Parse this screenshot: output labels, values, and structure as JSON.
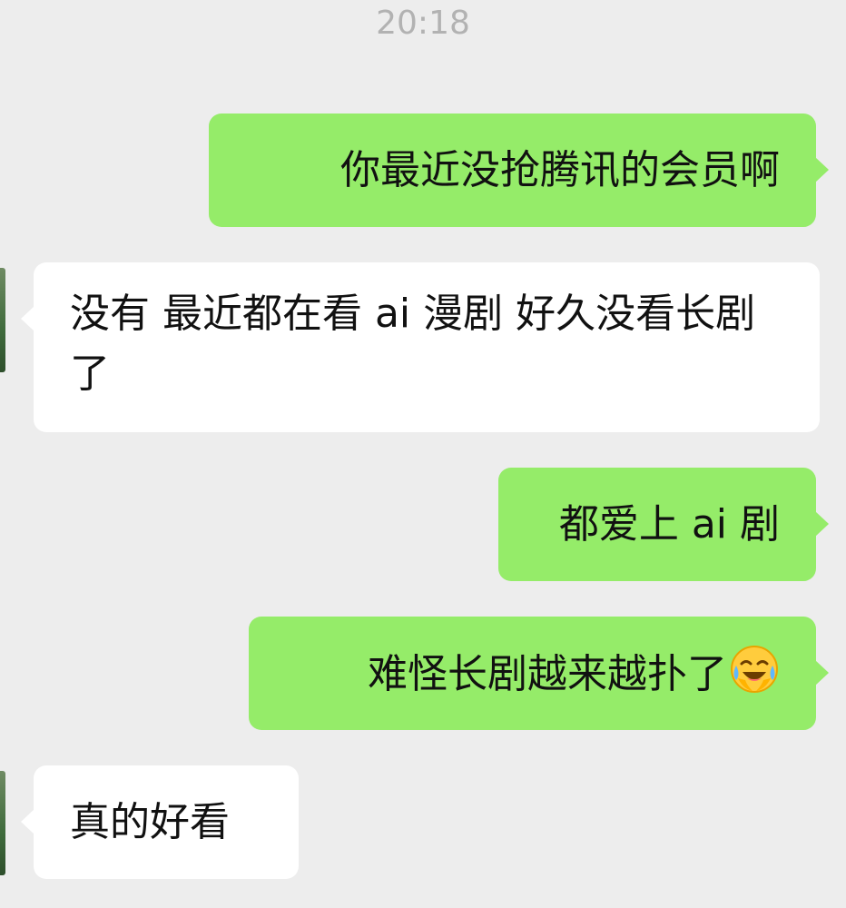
{
  "timestamp": "20:18",
  "messages": [
    {
      "side": "sent",
      "text": "你最近没抢腾讯的会员啊"
    },
    {
      "side": "received",
      "text": "没有 最近都在看 ai 漫剧 好久没看长剧了"
    },
    {
      "side": "sent",
      "text": "都爱上 ai 剧"
    },
    {
      "side": "sent",
      "text": "难怪长剧越来越扑了",
      "emoji": "face-with-tears-of-joy-icon"
    },
    {
      "side": "received",
      "text": "真的好看"
    }
  ],
  "colors": {
    "background": "#ededed",
    "sent_bubble": "#95ec69",
    "received_bubble": "#ffffff",
    "timestamp_text": "#b2b2b2",
    "message_text": "#111111"
  }
}
